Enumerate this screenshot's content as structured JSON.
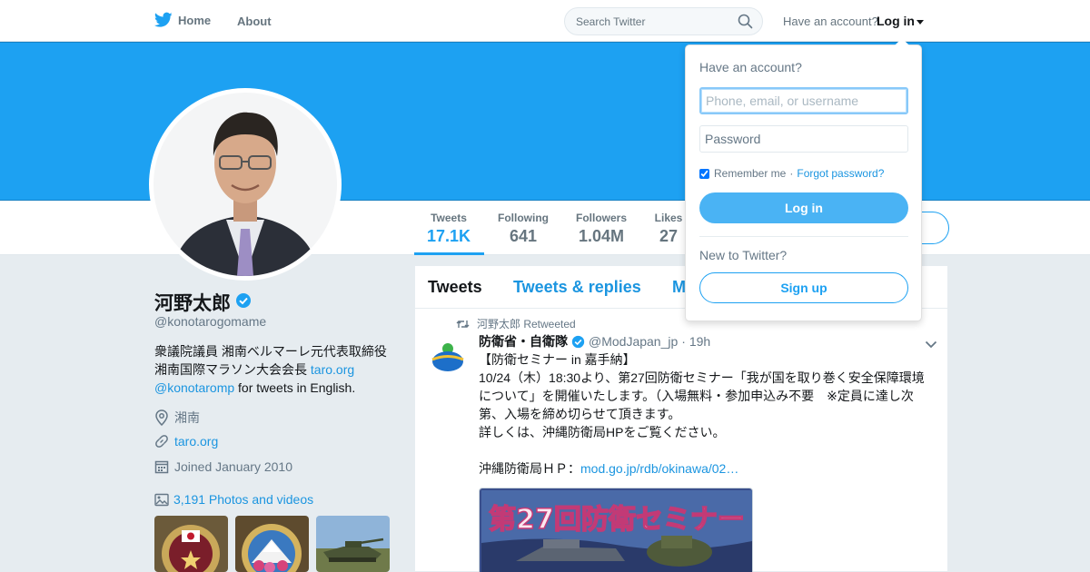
{
  "colors": {
    "brand_blue": "#1da1f2",
    "link_blue": "#1b95e0",
    "login_button": "#4ab3f4"
  },
  "topbar": {
    "home_label": "Home",
    "about_label": "About",
    "search_placeholder": "Search Twitter",
    "have_account": "Have an account?",
    "login_label": "Log in"
  },
  "profile_nav": {
    "stats": [
      {
        "label": "Tweets",
        "value": "17.1K"
      },
      {
        "label": "Following",
        "value": "641"
      },
      {
        "label": "Followers",
        "value": "1.04M"
      },
      {
        "label": "Likes",
        "value": "27"
      }
    ]
  },
  "profile": {
    "name": "河野太郎",
    "handle": "@konotarogomame",
    "bio_text": "衆議院議員 湘南ベルマーレ元代表取締役 湘南国際マラソン大会会長 ",
    "bio_link1": "taro.org",
    "bio_link2": "@konotaromp",
    "bio_tail": " for tweets in English.",
    "location": "湘南",
    "website": "taro.org",
    "joined": "Joined January 2010",
    "photos": "3,191 Photos and videos"
  },
  "timeline": {
    "tabs": [
      "Tweets",
      "Tweets & replies",
      "M"
    ],
    "retweet_line": "河野太郎 Retweeted",
    "tweet": {
      "fullname": "防衛省・自衛隊",
      "screen_name": "@ModJapan_jp",
      "time": "· 19h",
      "body": "【防衛セミナー in 嘉手納】\n10/24（木）18:30より、第27回防衛セミナー「我が国を取り巻く安全保障環境について」を開催いたします。（入場無料・参加申込み不要　※定員に達し次第、入場を締め切らせて頂きます。\n詳しくは、沖縄防衛局HPをご覧ください。\n\n沖縄防衛局ＨＰ：",
      "link": "mod.go.jp/rdb/okinawa/02…",
      "media_text": "第27回防衛セミナー"
    }
  },
  "login_dropdown": {
    "title": "Have an account?",
    "username_placeholder": "Phone, email, or username",
    "password_placeholder": "Password",
    "remember": "Remember me",
    "forgot": "Forgot password?",
    "login_button": "Log in",
    "new_to": "New to Twitter?",
    "signup_button": "Sign up"
  }
}
